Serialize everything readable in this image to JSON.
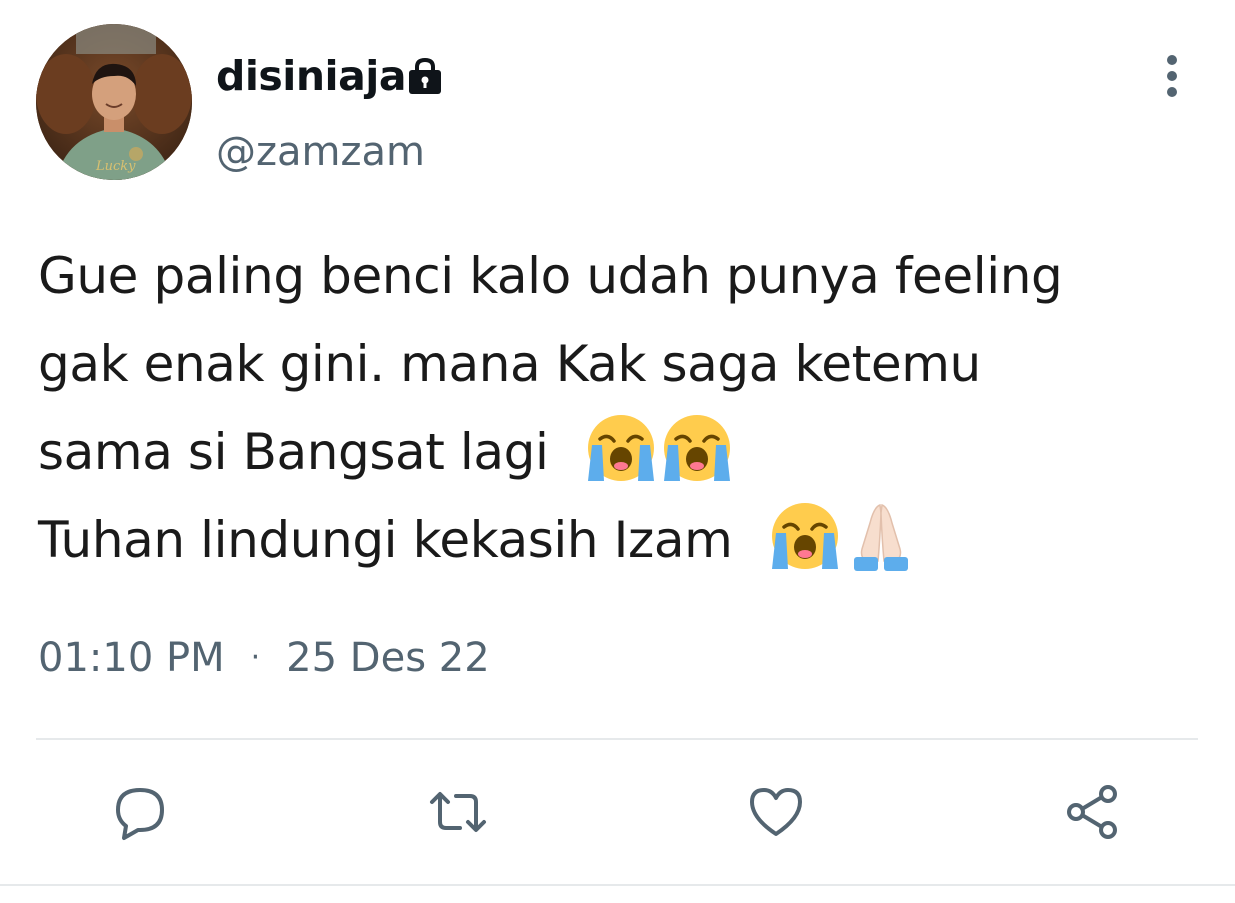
{
  "user": {
    "display_name": "disiniaja",
    "handle": "@zamzam",
    "avatar_icon": "profile-photo",
    "locked_icon": "lock-icon",
    "shirt_text": "Lucky"
  },
  "tweet": {
    "lines": [
      "Gue paling benci kalo udah punya feeling",
      "gak enak gini. mana Kak saga ketemu",
      "sama si Bangsat lagi",
      "Tuhan lindungi kekasih Izam"
    ],
    "time": "01:10 PM",
    "separator": "·",
    "date": "25 Des 22"
  },
  "actions": {
    "reply_icon": "reply-icon",
    "retweet_icon": "retweet-icon",
    "like_icon": "like-icon",
    "share_icon": "share-icon"
  },
  "colors": {
    "text": "#0f1419",
    "secondary": "#536471",
    "divider": "#e6e9eb"
  }
}
